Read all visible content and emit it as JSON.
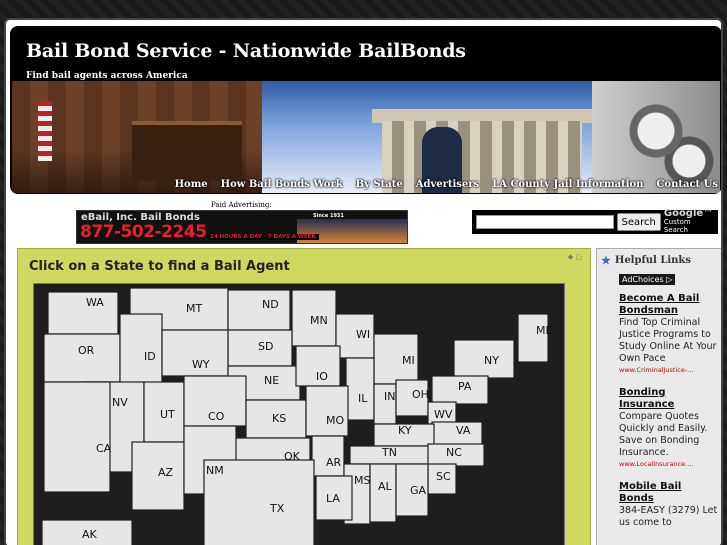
{
  "site": {
    "title": "Bail Bond Service - Nationwide BailBonds",
    "tagline": "Find bail agents across America"
  },
  "nav": [
    {
      "label": "Home"
    },
    {
      "label": "How Bail Bonds Work"
    },
    {
      "label": "By State"
    },
    {
      "label": "Advertisers"
    },
    {
      "label": "LA County Jail Information"
    },
    {
      "label": "Contact Us"
    }
  ],
  "ad": {
    "label": "Paid Advertising:",
    "brand": "eBail, Inc. Bail Bonds",
    "since": "Since 1931",
    "phone": "877-502-2245",
    "hours": "24 HOURS A DAY · 7 DAYS A WEEK"
  },
  "search": {
    "value": "",
    "button_label": "Search",
    "google_label": "Google™",
    "custom_label": "Custom Search"
  },
  "main": {
    "heading": "Click on a State to find a Bail Agent",
    "box_icons": "◆ ▢",
    "states": [
      "WA",
      "MT",
      "ND",
      "MN",
      "ME",
      "OR",
      "ID",
      "SD",
      "WI",
      "MI",
      "NY",
      "WY",
      "NE",
      "IO",
      "PA",
      "NV",
      "UT",
      "CO",
      "KS",
      "IL",
      "IN",
      "OH",
      "WV",
      "VA",
      "CA",
      "MO",
      "KY",
      "OK",
      "AZ",
      "NM",
      "TN",
      "NC",
      "AR",
      "SC",
      "MS",
      "AL",
      "GA",
      "TX",
      "LA",
      "AK"
    ]
  },
  "sidebar": {
    "title": "Helpful Links",
    "adchoices": "AdChoices ▷",
    "ads": [
      {
        "title": "Become A Bail Bondsman",
        "desc": "Find Top Criminal Justice Programs to Study Online At Your Own Pace",
        "url": "www.CriminalJustice-..."
      },
      {
        "title": "Bonding Insurance",
        "desc": "Compare Quotes Quickly and Easily. Save on Bonding Insurance.",
        "url": "www.LocalInsurance...."
      },
      {
        "title": "Mobile Bail Bonds",
        "desc": "384-EASY (3279) Let us come to",
        "url": ""
      }
    ]
  },
  "colors": {
    "header_bg": "#000000",
    "main_box": "#cfd85f",
    "state_fill": "#e6e6e6",
    "ad_phone": "#e8202a"
  }
}
